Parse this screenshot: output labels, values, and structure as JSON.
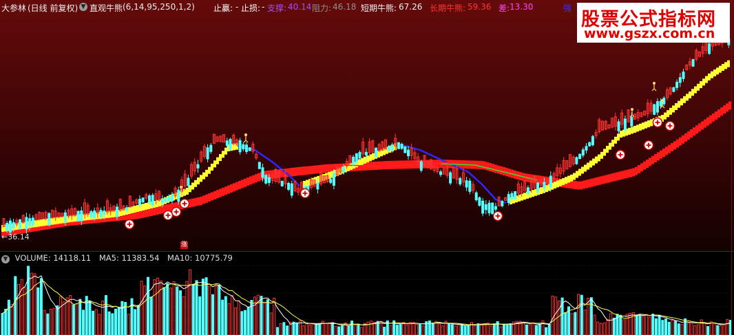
{
  "header": {
    "stock_name": "大参林",
    "adjust_label": "(日线 前复权)",
    "indicator_name": "直观牛熊",
    "indicator_params": "(6,14,95,250,1,2)",
    "stop_profit_label": "止赢:",
    "stop_profit_value": "-",
    "stop_loss_label": "止损:",
    "stop_loss_value": "-",
    "support_label": "支撑:",
    "support_value": "40.14",
    "resistance_label": "阻力:",
    "resistance_value": "46.18",
    "short_term_label": "短期牛熊:",
    "short_term_value": "67.26",
    "long_term_label": "长期牛熊:",
    "long_term_value": "59.36",
    "diff_label": "差:",
    "diff_value": "13.30",
    "extra_label": "强"
  },
  "watermark": {
    "line1": "股票公式指标网",
    "line2": "www.gszx.com.cn"
  },
  "price_panel": {
    "low_label": "←36.14",
    "zhang_tag": "涨"
  },
  "volume_panel": {
    "label": "VOLUME:",
    "value": "14118.11",
    "ma5_label": "MA5:",
    "ma5_value": "11383.54",
    "ma10_label": "MA10:",
    "ma10_value": "10775.79"
  },
  "colors": {
    "up": "#ff3333",
    "down": "#54ffff",
    "short_band": "#ffff33",
    "long_band": "#ff1a1a",
    "bear_line": "#2a2aff",
    "neutral_line": "#33dd33",
    "support": "#a050ff",
    "resistance": "#909090",
    "short_term_text": "#f0f0f0",
    "long_term_text": "#ff3333",
    "diff_text": "#ff44ff"
  },
  "icons": {
    "buy_signal": "plus-circle-icon",
    "person_marker": "person-icon",
    "collapse": "chevron-down-icon"
  }
}
